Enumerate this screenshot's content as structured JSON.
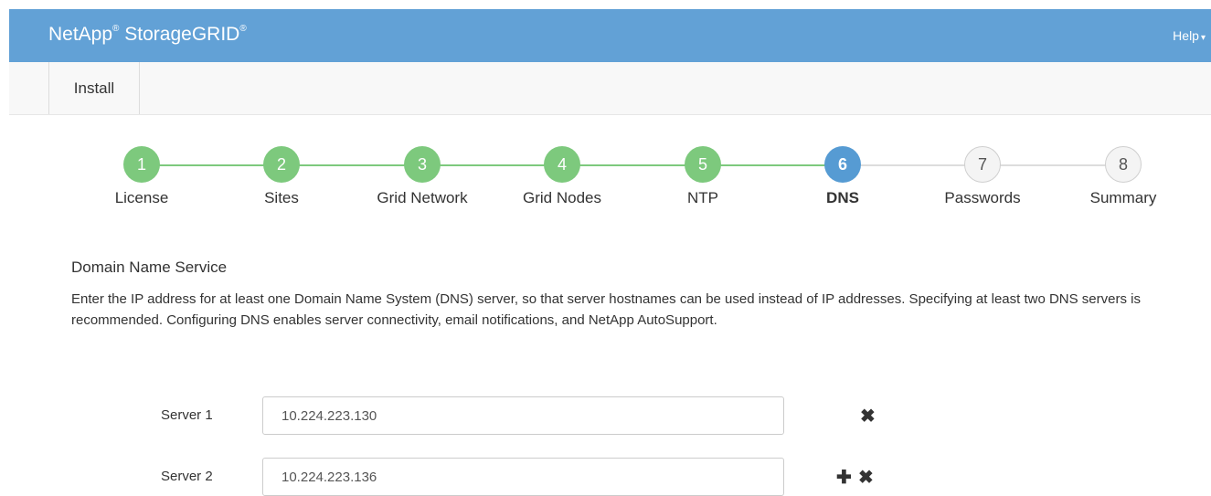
{
  "header": {
    "brand_name": "NetApp",
    "brand_mark": "®",
    "product_name": "StorageGRID",
    "product_mark": "®",
    "help_label": "Help",
    "help_caret": "▾"
  },
  "nav": {
    "install_label": "Install"
  },
  "steps": [
    {
      "number": "1",
      "label": "License",
      "state": "complete"
    },
    {
      "number": "2",
      "label": "Sites",
      "state": "complete"
    },
    {
      "number": "3",
      "label": "Grid Network",
      "state": "complete"
    },
    {
      "number": "4",
      "label": "Grid Nodes",
      "state": "complete"
    },
    {
      "number": "5",
      "label": "NTP",
      "state": "complete"
    },
    {
      "number": "6",
      "label": "DNS",
      "state": "active"
    },
    {
      "number": "7",
      "label": "Passwords",
      "state": "pending"
    },
    {
      "number": "8",
      "label": "Summary",
      "state": "pending"
    }
  ],
  "dns": {
    "title": "Domain Name Service",
    "description": "Enter the IP address for at least one Domain Name System (DNS) server, so that server hostnames can be used instead of IP addresses. Specifying at least two DNS servers is recommended. Configuring DNS enables server connectivity, email notifications, and NetApp AutoSupport.",
    "servers": [
      {
        "label": "Server 1",
        "value": "10.224.223.130",
        "actions": [
          "remove-icon"
        ]
      },
      {
        "label": "Server 2",
        "value": "10.224.223.136",
        "actions": [
          "add-icon",
          "remove-icon"
        ]
      }
    ],
    "add_glyph": "✚",
    "remove_glyph": "✖"
  },
  "colors": {
    "header_bg": "#62a1d6",
    "step_complete": "#7dc97d",
    "step_active": "#569bd3",
    "step_pending_bg": "#f4f4f4"
  }
}
